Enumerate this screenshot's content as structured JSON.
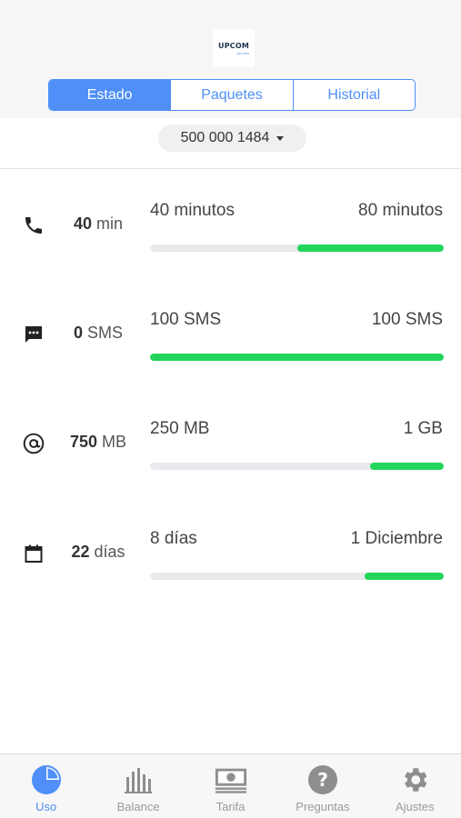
{
  "header": {
    "logo_text": "UPCOM",
    "logo_subtext": "cel.com"
  },
  "tabs": [
    {
      "label": "Estado",
      "active": true
    },
    {
      "label": "Paquetes",
      "active": false
    },
    {
      "label": "Historial",
      "active": false
    }
  ],
  "phone_number": "500 000 1484",
  "usage": [
    {
      "icon": "phone-icon",
      "amount": "40",
      "unit": "min",
      "left_label": "40 minutos",
      "right_label": "80 minutos",
      "fill_fraction": 0.5
    },
    {
      "icon": "message-icon",
      "amount": "0",
      "unit": "SMS",
      "left_label": "100 SMS",
      "right_label": "100 SMS",
      "fill_fraction": 1.0
    },
    {
      "icon": "at-icon",
      "amount": "750",
      "unit": "MB",
      "left_label": "250 MB",
      "right_label": "1 GB",
      "fill_fraction": 0.25
    },
    {
      "icon": "calendar-icon",
      "amount": "22",
      "unit": "días",
      "left_label": "8 días",
      "right_label": "1 Diciembre",
      "fill_fraction": 0.27
    }
  ],
  "bottom_tabs": [
    {
      "label": "Uso",
      "icon": "pie-chart-icon",
      "active": true
    },
    {
      "label": "Balance",
      "icon": "bar-chart-icon",
      "active": false
    },
    {
      "label": "Tarifa",
      "icon": "money-icon",
      "active": false
    },
    {
      "label": "Preguntas",
      "icon": "question-icon",
      "active": false
    },
    {
      "label": "Ajustes",
      "icon": "gear-icon",
      "active": false
    }
  ],
  "colors": {
    "accent": "#4f8ff7",
    "progress": "#22d55a",
    "track": "#e8eaed"
  }
}
